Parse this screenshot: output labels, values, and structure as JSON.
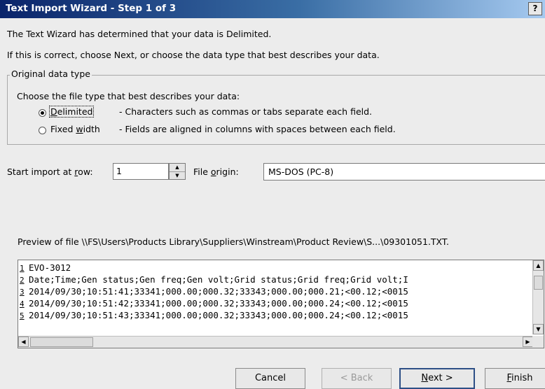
{
  "window": {
    "title": "Text Import Wizard - Step 1 of 3",
    "help_label": "?"
  },
  "intro": {
    "line1": "The Text Wizard has determined that your data is Delimited.",
    "line2": "If this is correct, choose Next, or choose the data type that best describes your data."
  },
  "original_data_type": {
    "legend": "Original data type",
    "prompt": "Choose the file type that best describes your data:",
    "options": [
      {
        "label_pre": "",
        "label_key": "D",
        "label_post": "elimited",
        "description": "- Characters such as commas or tabs separate each field.",
        "selected": true
      },
      {
        "label_pre": "Fixed ",
        "label_key": "w",
        "label_post": "idth",
        "description": "- Fields are aligned in columns with spaces between each field.",
        "selected": false
      }
    ]
  },
  "start_row": {
    "label_pre": "Start import at ",
    "label_key": "r",
    "label_post": "ow:",
    "value": "1"
  },
  "file_origin": {
    "label_pre": "File ",
    "label_key": "o",
    "label_post": "rigin:",
    "value": "MS-DOS (PC-8)"
  },
  "preview": {
    "label": "Preview of file \\\\FS\\Users\\Products Library\\Suppliers\\Winstream\\Product Review\\S...\\09301051.TXT.",
    "lines": [
      {
        "num": "1",
        "text": "EVO-3012"
      },
      {
        "num": "2",
        "text": "Date;Time;Gen status;Gen freq;Gen volt;Grid status;Grid freq;Grid volt;I"
      },
      {
        "num": "3",
        "text": "2014/09/30;10:51:41;33341;000.00;000.32;33343;000.00;000.21;<00.12;<0015"
      },
      {
        "num": "4",
        "text": "2014/09/30;10:51:42;33341;000.00;000.32;33343;000.00;000.24;<00.12;<0015"
      },
      {
        "num": "5",
        "text": "2014/09/30;10:51:43;33341;000.00;000.32;33343;000.00;000.24;<00.12;<0015"
      }
    ]
  },
  "buttons": {
    "cancel": "Cancel",
    "back": "< Back",
    "next_pre": "",
    "next_key": "N",
    "next_post": "ext >",
    "finish_pre": "",
    "finish_key": "F",
    "finish_post": "inish"
  }
}
